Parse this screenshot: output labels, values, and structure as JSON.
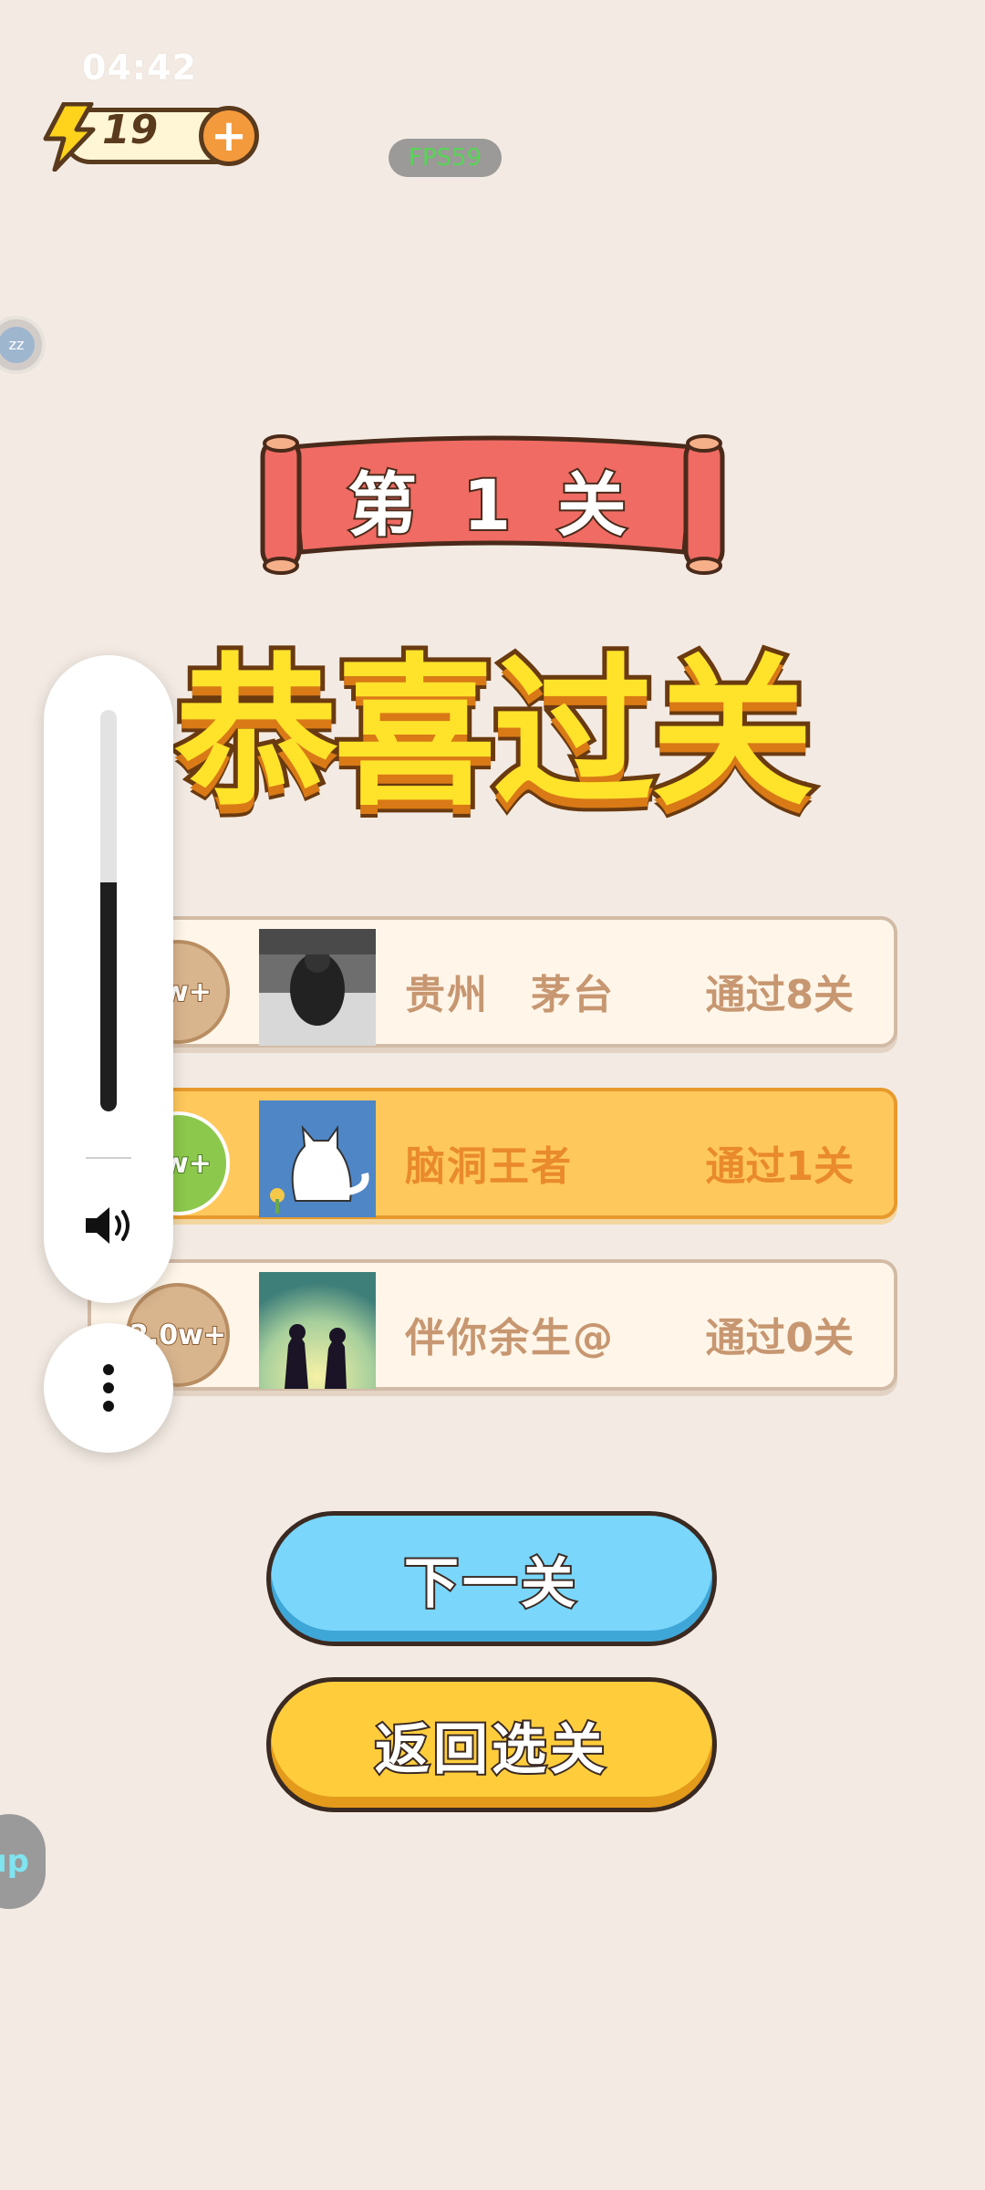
{
  "status_bar": {
    "time": "04:42"
  },
  "energy": {
    "count": "19"
  },
  "fps": "FPS59",
  "floating_bubble": {
    "label": "zz"
  },
  "banner": {
    "level_label": "第 1 关"
  },
  "title": "恭喜过关",
  "leaderboard": {
    "rows": [
      {
        "badge": "0w+",
        "name": "贵州　茅台",
        "status": "通过8关",
        "highlight": false,
        "avatar": "dark-person-photo"
      },
      {
        "badge": "0w+",
        "name": "脑洞王者",
        "status": "通过1关",
        "highlight": true,
        "avatar": "white-cat-illustration"
      },
      {
        "badge": "2.0w+",
        "name": "伴你余生@",
        "status": "通过0关",
        "highlight": false,
        "avatar": "couple-silhouette"
      }
    ]
  },
  "buttons": {
    "next": "下一关",
    "back": "返回选关"
  },
  "volume_overlay": {
    "level_percent": 57
  },
  "side_bubble": {
    "label": "up"
  },
  "colors": {
    "background": "#f3ebe3",
    "accent_orange": "#ffc85c",
    "button_blue": "#7ad7fb",
    "button_yellow": "#ffcd3c"
  }
}
